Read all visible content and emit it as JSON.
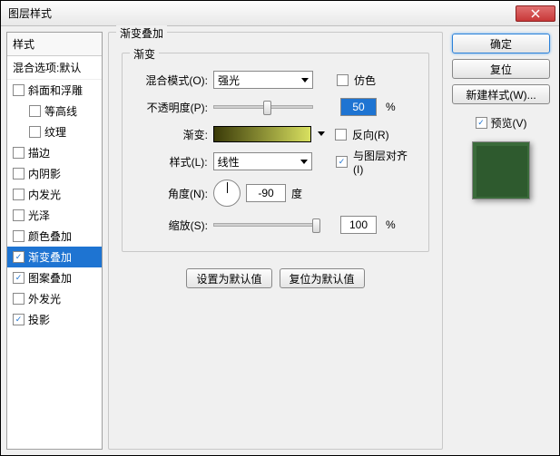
{
  "window": {
    "title": "图层样式"
  },
  "left": {
    "header": "样式",
    "sub": "混合选项:默认",
    "items": [
      {
        "label": "斜面和浮雕",
        "checked": false
      },
      {
        "label": "等高线",
        "checked": false,
        "indent": true
      },
      {
        "label": "纹理",
        "checked": false,
        "indent": true
      },
      {
        "label": "描边",
        "checked": false
      },
      {
        "label": "内阴影",
        "checked": false
      },
      {
        "label": "内发光",
        "checked": false
      },
      {
        "label": "光泽",
        "checked": false
      },
      {
        "label": "颜色叠加",
        "checked": false
      },
      {
        "label": "渐变叠加",
        "checked": true,
        "selected": true
      },
      {
        "label": "图案叠加",
        "checked": true
      },
      {
        "label": "外发光",
        "checked": false
      },
      {
        "label": "投影",
        "checked": true
      }
    ]
  },
  "center": {
    "outer_title": "渐变叠加",
    "inner_title": "渐变",
    "blend_label": "混合模式(O):",
    "blend_value": "强光",
    "dither_label": "仿色",
    "opacity_label": "不透明度(P):",
    "opacity_value": "50",
    "opacity_pct": "%",
    "gradient_label": "渐变:",
    "reverse_label": "反向(R)",
    "style_label": "样式(L):",
    "style_value": "线性",
    "align_label": "与图层对齐(I)",
    "angle_label": "角度(N):",
    "angle_value": "-90",
    "angle_unit": "度",
    "scale_label": "缩放(S):",
    "scale_value": "100",
    "scale_pct": "%",
    "btn_default": "设置为默认值",
    "btn_reset": "复位为默认值"
  },
  "right": {
    "ok": "确定",
    "cancel": "复位",
    "new_style": "新建样式(W)...",
    "preview_label": "预览(V)",
    "preview_checked": true
  }
}
